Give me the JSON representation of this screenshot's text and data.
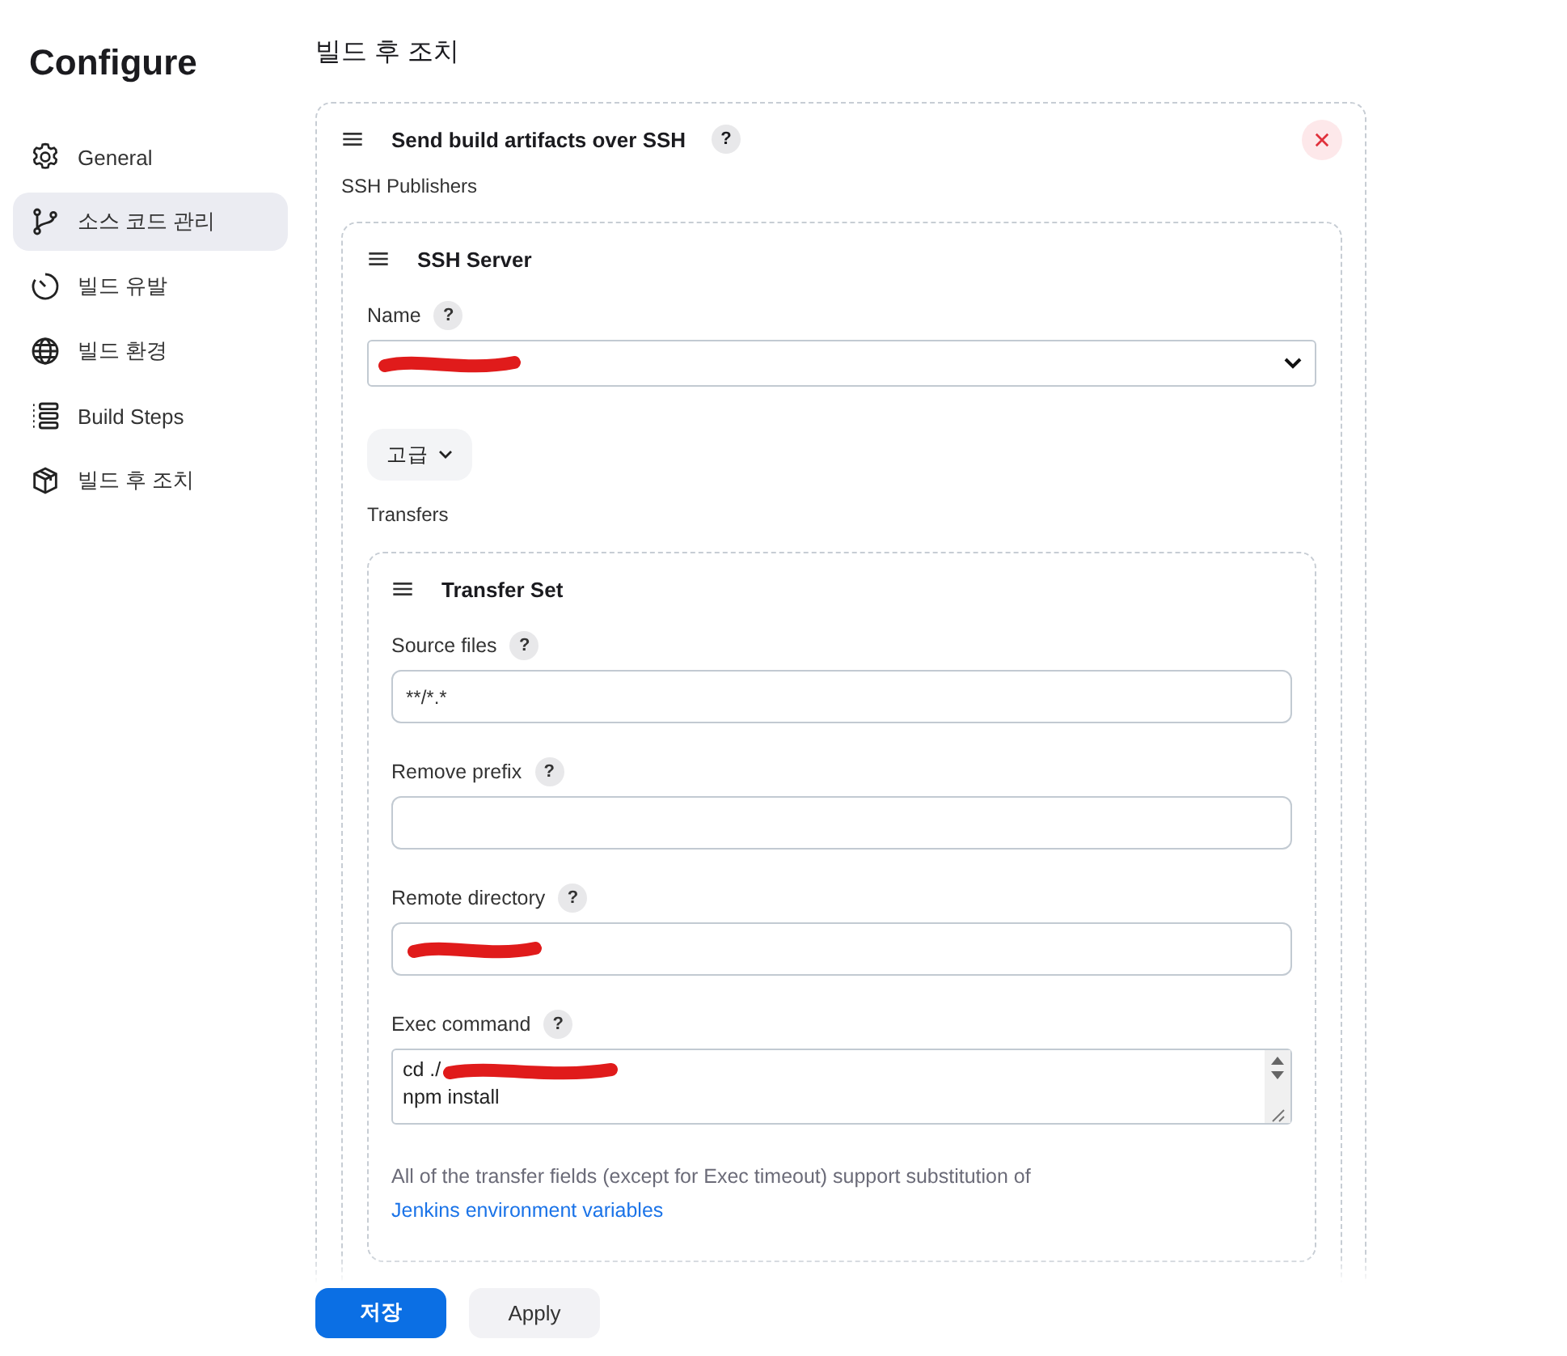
{
  "sidebar": {
    "title": "Configure",
    "items": [
      {
        "label": "General",
        "selected": false
      },
      {
        "label": "소스 코드 관리",
        "selected": true
      },
      {
        "label": "빌드 유발",
        "selected": false
      },
      {
        "label": "빌드 환경",
        "selected": false
      },
      {
        "label": "Build Steps",
        "selected": false
      },
      {
        "label": "빌드 후 조치",
        "selected": false
      }
    ]
  },
  "section_title": "빌드 후 조치",
  "step": {
    "title": "Send build artifacts over SSH",
    "help": "?",
    "publishers_label": "SSH Publishers"
  },
  "server": {
    "title": "SSH Server",
    "name_label": "Name",
    "name_help": "?",
    "name_redacted": true,
    "advanced_button": "고급",
    "transfers_label": "Transfers"
  },
  "transfer_set": {
    "title": "Transfer Set",
    "fields": [
      {
        "kind": "input",
        "label": "Source files",
        "help": "?",
        "value": "**/*.*",
        "redacted": false
      },
      {
        "kind": "input",
        "label": "Remove prefix",
        "help": "?",
        "redacted": false
      },
      {
        "kind": "input",
        "label": "Remote directory",
        "help": "?",
        "redacted": true
      },
      {
        "kind": "textarea",
        "label": "Exec command",
        "help": "?",
        "lines": [
          "cd ./",
          "npm install"
        ],
        "redacted": true
      }
    ],
    "note": "All of the transfer fields (except for Exec timeout) support substitution of ",
    "note_link": "Jenkins environment variables"
  },
  "buttons": [
    {
      "label": "저장",
      "kind": "primary"
    },
    {
      "label": "Apply",
      "kind": "secondary"
    }
  ]
}
